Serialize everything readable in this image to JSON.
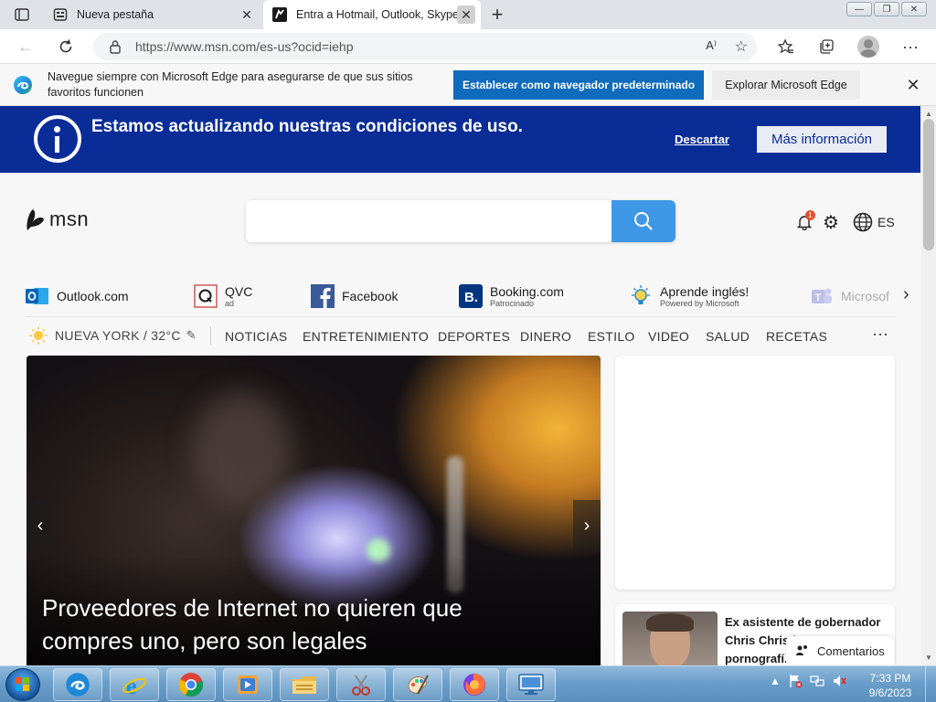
{
  "browser": {
    "tabs": [
      {
        "title": "Nueva pestaña",
        "favicon": "newtab-icon"
      },
      {
        "title": "Entra a Hotmail, Outlook, Skype",
        "favicon": "msn-icon"
      }
    ],
    "url": "https://www.msn.com/es-us?ocid=iehp",
    "read_aloud": "A⁾"
  },
  "infobar": {
    "message": "Navegue siempre con Microsoft Edge para asegurarse de que sus sitios favoritos funcionen",
    "primary_button": "Establecer como navegador predeterminado",
    "secondary_button": "Explorar Microsoft Edge"
  },
  "terms_banner": {
    "text": "Estamos actualizando nuestras condiciones de uso.",
    "dismiss": "Descartar",
    "more_info": "Más información"
  },
  "msn": {
    "brand": "msn",
    "notification_count": "1",
    "language": "ES",
    "accent": "#3f98e6"
  },
  "quicklinks": [
    {
      "name": "Outlook.com",
      "sub": ""
    },
    {
      "name": "QVC",
      "sub": "ad"
    },
    {
      "name": "Facebook",
      "sub": ""
    },
    {
      "name": "Booking.com",
      "sub": "Patrocinado"
    },
    {
      "name": "Aprende inglés!",
      "sub": "Powered by Microsoft"
    },
    {
      "name": "Microsof",
      "sub": ""
    }
  ],
  "nav": {
    "weather": "NUEVA YORK / 32°C",
    "items": [
      "NOTICIAS",
      "ENTRETENIMIENTO",
      "DEPORTES",
      "DINERO",
      "ESTILO",
      "VIDEO",
      "SALUD",
      "RECETAS"
    ],
    "more": "···"
  },
  "hero": {
    "title": "Proveedores de Internet no quieren que compres uno, pero son legales"
  },
  "side_news": {
    "headline": "Ex asistente de gobernador Chris Christie ... pornografí..."
  },
  "comments": {
    "label": "Comentarios"
  },
  "taskbar": {
    "time": "7:33 PM",
    "date": "9/6/2023"
  }
}
